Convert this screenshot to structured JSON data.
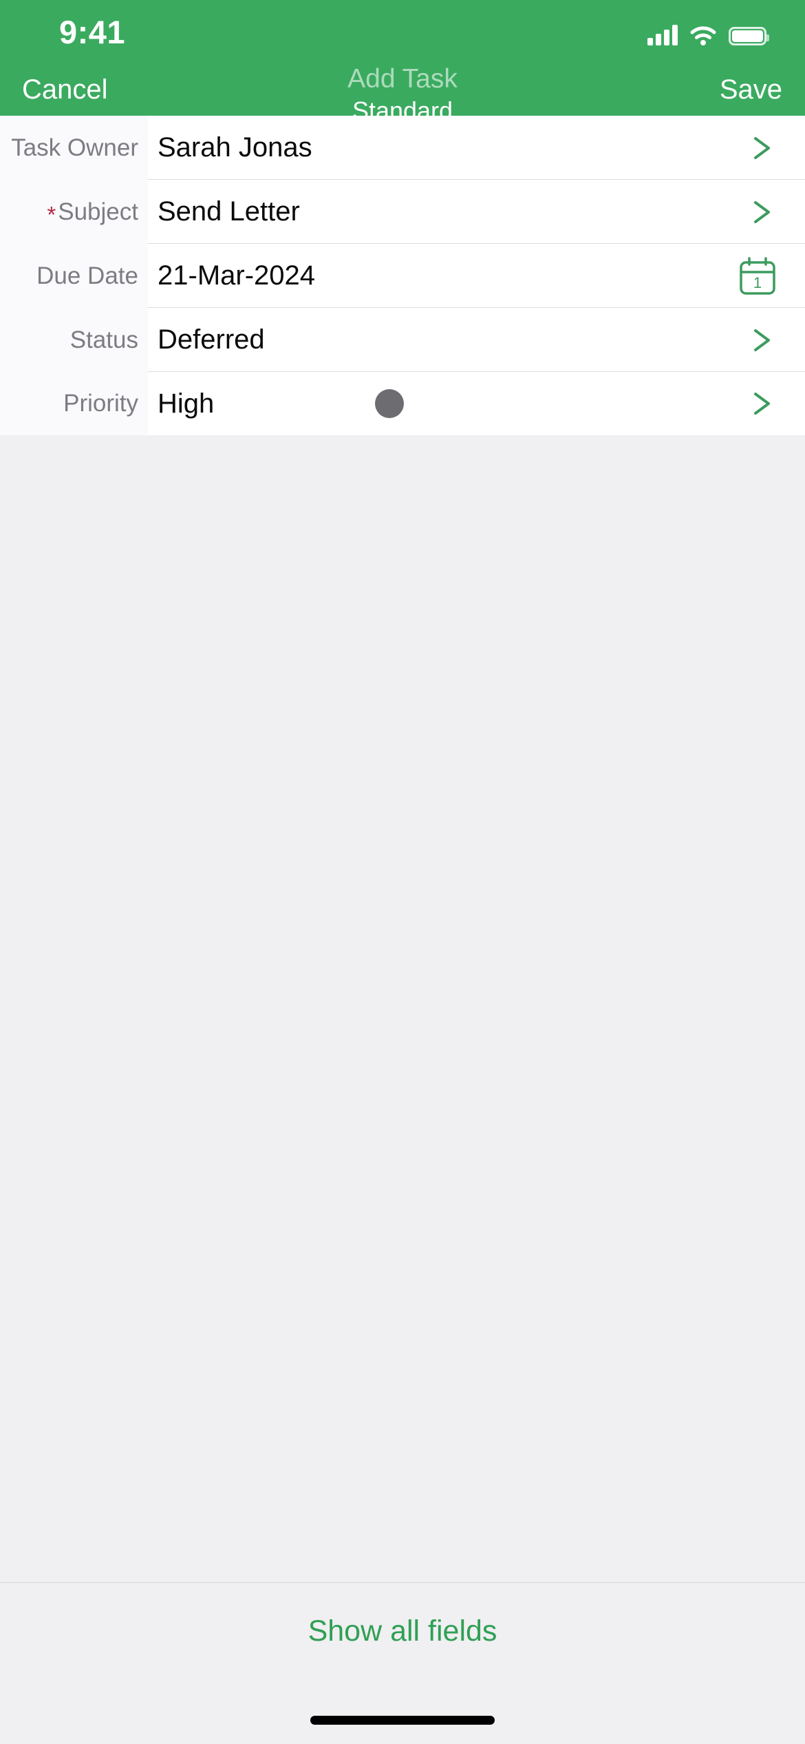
{
  "status_bar": {
    "time": "9:41",
    "cellular_icon": "signal-bars-icon",
    "wifi_icon": "wifi-icon",
    "battery_icon": "battery-icon"
  },
  "nav": {
    "cancel_label": "Cancel",
    "title": "Add Task",
    "subtitle": "Standard",
    "save_label": "Save"
  },
  "theme": {
    "header_green": "#3AAA5F",
    "accent_green": "#2FA055",
    "required_red": "#B02A45",
    "label_gray": "#7C7C83",
    "priority_dot_gray": "#6C6C71",
    "body_gray": "#F0EFF1",
    "label_col_bg": "#FAF9FB"
  },
  "form": {
    "rows": [
      {
        "label": "Task Owner",
        "required": false,
        "value": "Sarah Jonas",
        "accessory": "chevron-right-icon"
      },
      {
        "label": "Subject",
        "required": true,
        "required_marker": "*",
        "value": "Send Letter",
        "accessory": "chevron-right-icon"
      },
      {
        "label": "Due Date",
        "required": false,
        "value": "21-Mar-2024",
        "accessory": "calendar-icon",
        "calendar_day": "1"
      },
      {
        "label": "Status",
        "required": false,
        "value": "Deferred",
        "accessory": "chevron-right-icon"
      },
      {
        "label": "Priority",
        "required": false,
        "value": "High",
        "accessory": "chevron-right-icon",
        "indicator": "priority-dot"
      }
    ]
  },
  "footer": {
    "show_all_fields_label": "Show all fields",
    "home_indicator": "home-indicator"
  }
}
